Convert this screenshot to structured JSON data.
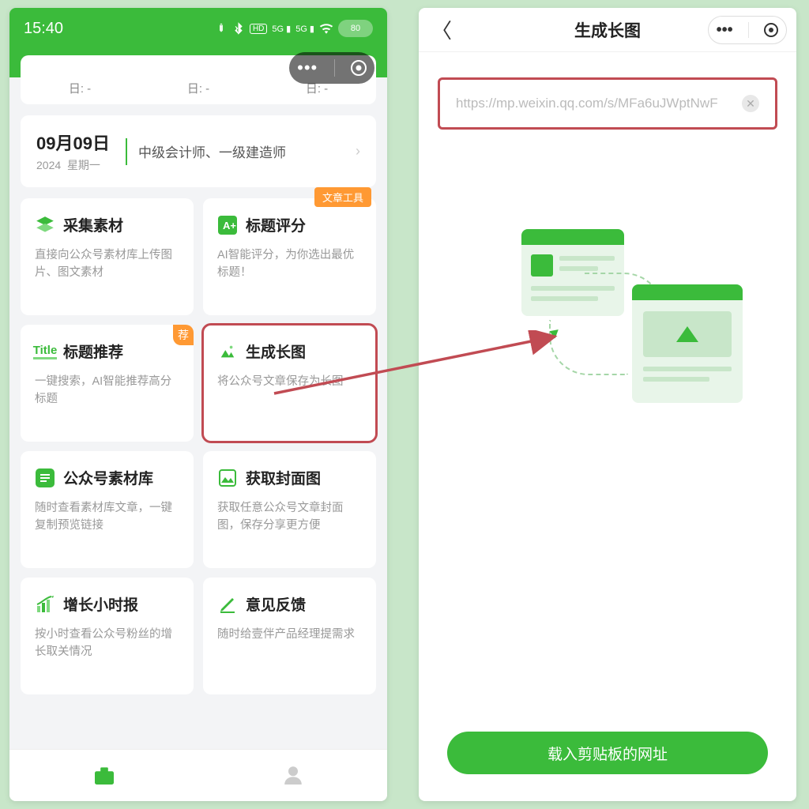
{
  "status": {
    "time": "15:40",
    "battery": "80"
  },
  "strip": [
    "日: -",
    "日: -",
    "日: -"
  ],
  "date": {
    "big": "09月09日",
    "year": "2024",
    "weekday": "星期一",
    "text": "中级会计师、一级建造师"
  },
  "grid_tag": "文章工具",
  "cells": [
    {
      "title": "采集素材",
      "desc": "直接向公众号素材库上传图片、图文素材"
    },
    {
      "title": "标题评分",
      "desc": "AI智能评分，为你选出最优标题！"
    },
    {
      "title": "标题推荐",
      "desc": "一键搜索，AI智能推荐高分标题",
      "hot": "荐"
    },
    {
      "title": "生成长图",
      "desc": "将公众号文章保存为长图"
    },
    {
      "title": "公众号素材库",
      "desc": "随时查看素材库文章，一键复制预览链接"
    },
    {
      "title": "获取封面图",
      "desc": "获取任意公众号文章封面图，保存分享更方便"
    },
    {
      "title": "增长小时报",
      "desc": "按小时查看公众号粉丝的增长取关情况"
    },
    {
      "title": "意见反馈",
      "desc": "随时给壹伴产品经理提需求"
    }
  ],
  "right": {
    "title": "生成长图",
    "url_placeholder": "https://mp.weixin.qq.com/s/MFa6uJWptNwF",
    "cta": "载入剪贴板的网址"
  }
}
